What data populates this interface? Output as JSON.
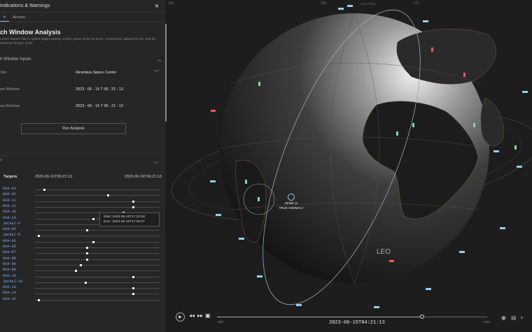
{
  "panel": {
    "title": "Indications & Warnings",
    "close": "×",
    "tabs": [
      "h",
      "Access"
    ],
    "section_title": "ch Window Analysis",
    "description": "Lorem launch site to space target pairing. Lorem ipsum dolor sit amet, consectetur adipiscing elit, sed do eiusmod tempor incid.",
    "inputs_header": "h Window Inputs",
    "site_label": "Site",
    "site_value": "Alcantara Space Center",
    "start_label": "ow Window",
    "start_value": "2023 - 06 - 15 T 06 : 21 : 13",
    "end_label": "ow Window",
    "end_value": "2023 - 06 - 16 T 06 : 21 : 13",
    "run_button": "Run Analysis",
    "results_label": "s",
    "targets_header": "Targets",
    "timeline_start": "2023-06-15T06:21:13",
    "timeline_end": "2023-06-16T06:21:13",
    "tooltip_start": "Start: 2023-06-15T17:21:08",
    "tooltip_end": "End : 2023-06-15T17:25:07"
  },
  "targets": [
    {
      "name": "HVA-01",
      "pos": 0.07
    },
    {
      "name": "HVA-02",
      "pos": 0.58
    },
    {
      "name": "HVA-11",
      "pos": 0.78
    },
    {
      "name": "HVA-12",
      "pos": 0.78
    },
    {
      "name": "HVA-18",
      "pos": 0.7
    },
    {
      "name": "HVA-20",
      "pos": 0.46
    },
    {
      "name": "Jackal-6",
      "pos": 0.58
    },
    {
      "name": "HVA-04",
      "pos": 0.41
    },
    {
      "name": "Jackal-5",
      "pos": 0.02
    },
    {
      "name": "HVA-03",
      "pos": 0.46
    },
    {
      "name": "HVA-05",
      "pos": 0.41
    },
    {
      "name": "HVA-07",
      "pos": 0.41
    },
    {
      "name": "HVA-06",
      "pos": 0.41
    },
    {
      "name": "HVA-09",
      "pos": 0.36
    },
    {
      "name": "HVA-08",
      "pos": 0.32
    },
    {
      "name": "HVA-10",
      "pos": 0.78
    },
    {
      "name": "Jackal-15",
      "pos": 0.4
    },
    {
      "name": "HVA-13",
      "pos": 0.78
    },
    {
      "name": "HVA-14",
      "pos": 0.78
    },
    {
      "name": "HVA-15",
      "pos": 0.02
    }
  ],
  "globe": {
    "orbit_label": "LEO",
    "selected_name": "Jackal 12",
    "selected_status": "TRUE ANOMALY",
    "scale_labels": [
      "300",
      "180",
      "120"
    ],
    "zone_label": "LOCATION"
  },
  "playback": {
    "current_time": "2023-06-15T04:21:13",
    "range_start": "-24h",
    "range_end": "+24h",
    "progress": 0.76
  }
}
